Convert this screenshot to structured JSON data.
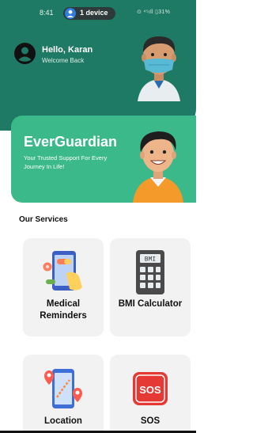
{
  "status_bar": {
    "time": "8:41",
    "device_label": "1 device",
    "indicators": "⊙ ⁴⁵ıll ▯31%"
  },
  "header": {
    "greeting": "Hello, Karan",
    "subtitle": "Welcome Back",
    "background_color": "#1f7a65"
  },
  "banner": {
    "title": "EverGuardian",
    "tagline": "Your Trusted Support For Every Journey In Life!",
    "background_color": "#3bb98b"
  },
  "services": {
    "section_title": "Our Services",
    "items": [
      {
        "label": "Medical Reminders",
        "icon": "phone-pills-icon"
      },
      {
        "label": "BMI Calculator",
        "icon": "calculator-icon",
        "icon_text": "BMI"
      },
      {
        "label": "Location",
        "icon": "map-pin-icon"
      },
      {
        "label": "SOS",
        "icon": "sos-icon",
        "icon_text": "SOS"
      }
    ]
  }
}
